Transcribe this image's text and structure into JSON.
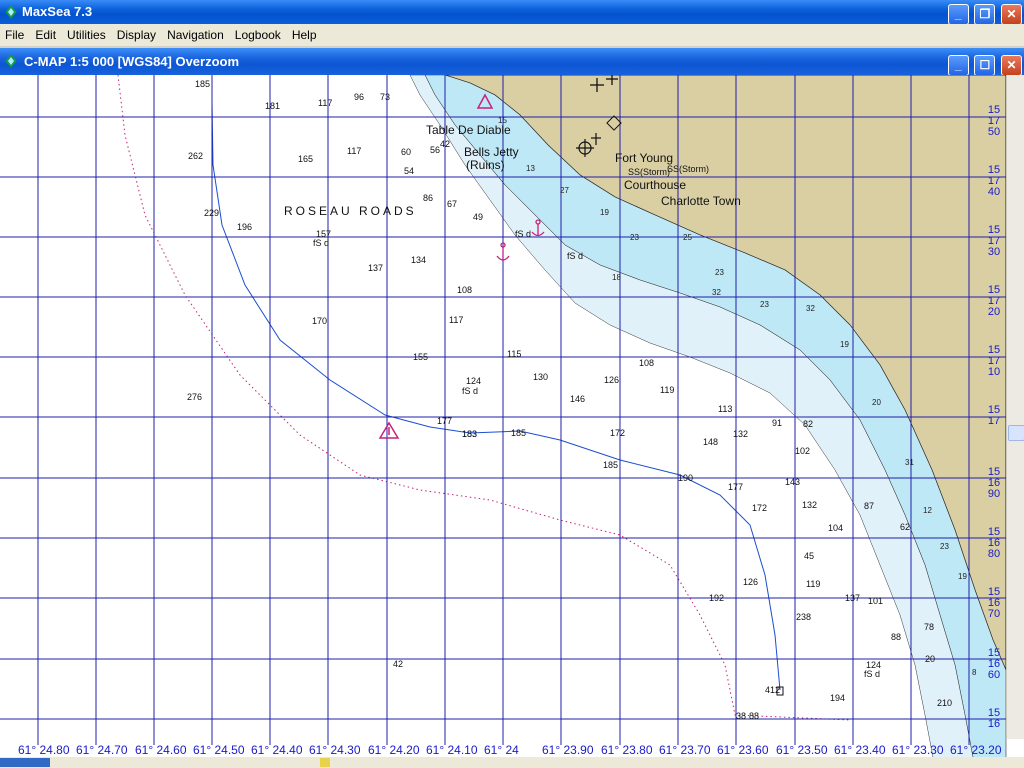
{
  "app": {
    "title": "MaxSea 7.3"
  },
  "menu": {
    "items": [
      "File",
      "Edit",
      "Utilities",
      "Display",
      "Navigation",
      "Logbook",
      "Help"
    ]
  },
  "child_window": {
    "title": "C-MAP  1:5 000 [WGS84]    Overzoom"
  },
  "colors": {
    "land": "#d9cfa3",
    "shallow": "#bfe8f7",
    "mid": "#e1f1fa",
    "deep": "#ffffff",
    "grid": "#1f1fa8",
    "magenta": "#c8207c",
    "accent_blue": "#1a4fd0"
  },
  "chart": {
    "place_names": [
      "ROSEAU ROADS",
      "Table De Diable",
      "Bells Jetty",
      "(Ruins)",
      "Fort Young",
      "Courthouse",
      "Charlotte Town",
      "SS(Storm)",
      "SS(Storm)"
    ],
    "seabed_notes": [
      "fS d",
      "fS d",
      "fS d",
      "fS d",
      "fS d"
    ],
    "soundings": [
      "185",
      "181",
      "117",
      "96",
      "73",
      "262",
      "165",
      "117",
      "60",
      "56",
      "54",
      "229",
      "196",
      "86",
      "67",
      "49",
      "157",
      "137",
      "134",
      "108",
      "117",
      "170",
      "155",
      "124",
      "115",
      "130",
      "126",
      "108",
      "119",
      "146",
      "276",
      "177",
      "183",
      "185",
      "172",
      "148",
      "132",
      "113",
      "102",
      "91",
      "82",
      "185",
      "190",
      "177",
      "172",
      "143",
      "132",
      "104",
      "87",
      "62",
      "45",
      "119",
      "126",
      "192",
      "238",
      "137",
      "101",
      "88",
      "78",
      "42",
      "412",
      "194",
      "124",
      "88",
      "210",
      "20",
      "38",
      "42"
    ],
    "contour_labels": [
      "183",
      "210"
    ],
    "bottom_axis": [
      "61° 24.80",
      "61° 24.70",
      "61° 24.60",
      "61° 24.50",
      "61° 24.40",
      "61° 24.30",
      "61° 24.20",
      "61° 24.10",
      "61° 24",
      "61° 23.90",
      "61° 23.80",
      "61° 23.70",
      "61° 23.60",
      "61° 23.50",
      "61° 23.40",
      "61° 23.30",
      "61° 23.20"
    ],
    "right_axis": [
      {
        "deg": "15",
        "min": "17",
        "sec": "50"
      },
      {
        "deg": "15",
        "min": "17",
        "sec": "40"
      },
      {
        "deg": "15",
        "min": "17",
        "sec": "30"
      },
      {
        "deg": "15",
        "min": "17",
        "sec": "20"
      },
      {
        "deg": "15",
        "min": "17",
        "sec": "10"
      },
      {
        "deg": "15",
        "min": "17",
        "sec": ""
      },
      {
        "deg": "15",
        "min": "16",
        "sec": "90"
      },
      {
        "deg": "15",
        "min": "16",
        "sec": "80"
      },
      {
        "deg": "15",
        "min": "16",
        "sec": "70"
      },
      {
        "deg": "15",
        "min": "16",
        "sec": "60"
      },
      {
        "deg": "15",
        "min": "16",
        "sec": ""
      }
    ]
  }
}
